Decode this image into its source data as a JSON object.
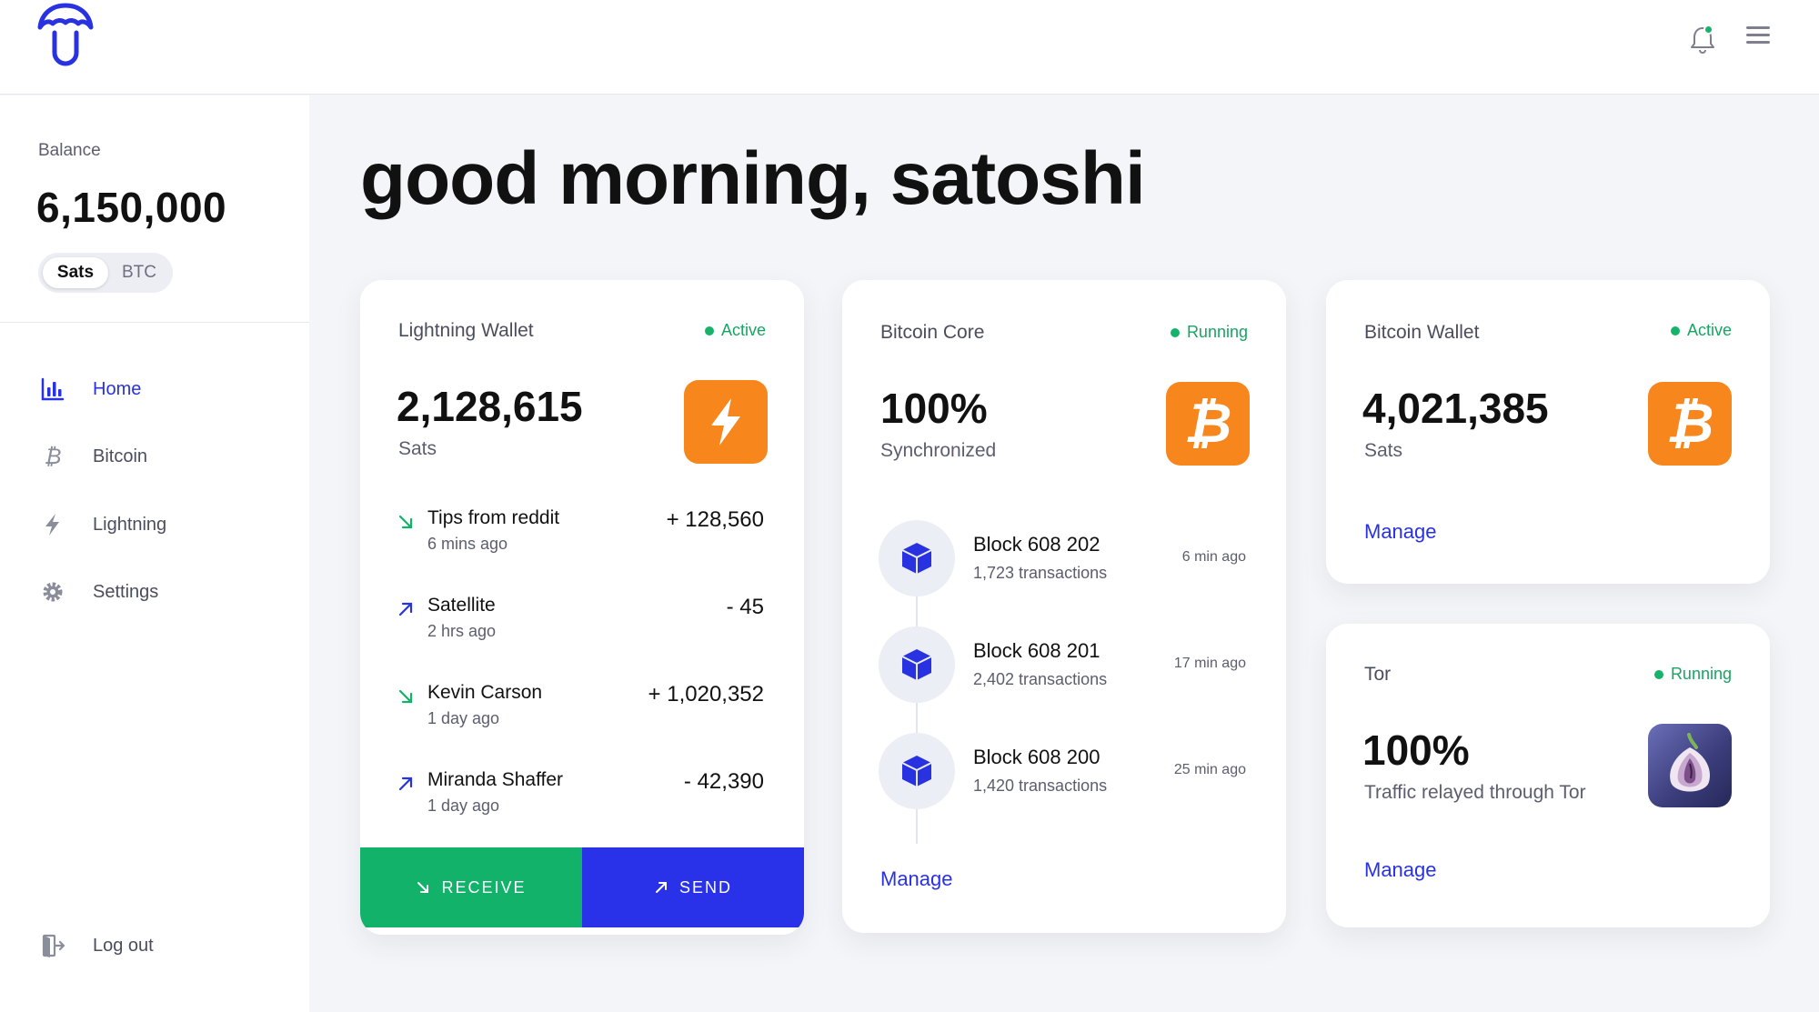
{
  "header": {
    "logo": "umbrel-logo",
    "notification_icon": "bell-icon",
    "menu_icon": "hamburger-icon"
  },
  "sidebar": {
    "balance_label": "Balance",
    "balance_value": "6,150,000",
    "units": {
      "selected": "Sats",
      "other": "BTC"
    },
    "nav": [
      {
        "label": "Home",
        "icon": "bar-chart-icon",
        "active": true
      },
      {
        "label": "Bitcoin",
        "icon": "bitcoin-icon",
        "active": false
      },
      {
        "label": "Lightning",
        "icon": "lightning-icon",
        "active": false
      },
      {
        "label": "Settings",
        "icon": "gear-icon",
        "active": false
      }
    ],
    "logout_label": "Log out"
  },
  "greeting": "good morning, satoshi",
  "lightning_wallet": {
    "title": "Lightning Wallet",
    "status": "Active",
    "balance": "2,128,615",
    "unit": "Sats",
    "transactions": [
      {
        "name": "Tips from reddit",
        "time": "6 mins ago",
        "amount": "+ 128,560",
        "direction": "in"
      },
      {
        "name": "Satellite",
        "time": "2 hrs ago",
        "amount": "- 45",
        "direction": "out"
      },
      {
        "name": "Kevin Carson",
        "time": "1 day ago",
        "amount": "+ 1,020,352",
        "direction": "in"
      },
      {
        "name": "Miranda Shaffer",
        "time": "1 day ago",
        "amount": "- 42,390",
        "direction": "out"
      }
    ],
    "receive_label": "RECEIVE",
    "send_label": "SEND"
  },
  "bitcoin_core": {
    "title": "Bitcoin Core",
    "status": "Running",
    "sync_percent": "100%",
    "sync_label": "Synchronized",
    "blocks": [
      {
        "name": "Block 608 202",
        "transactions": "1,723 transactions",
        "ago": "6 min ago"
      },
      {
        "name": "Block 608 201",
        "transactions": "2,402 transactions",
        "ago": "17 min ago"
      },
      {
        "name": "Block 608 200",
        "transactions": "1,420 transactions",
        "ago": "25 min ago"
      }
    ],
    "manage_label": "Manage"
  },
  "bitcoin_wallet": {
    "title": "Bitcoin Wallet",
    "status": "Active",
    "balance": "4,021,385",
    "unit": "Sats",
    "manage_label": "Manage"
  },
  "tor": {
    "title": "Tor",
    "status": "Running",
    "percent": "100%",
    "description": "Traffic relayed through Tor",
    "manage_label": "Manage"
  },
  "colors": {
    "accent": "#2932e1",
    "success": "#17b36b",
    "orange": "#f7861d",
    "send": "#2932e8",
    "receive": "#12b26b"
  }
}
